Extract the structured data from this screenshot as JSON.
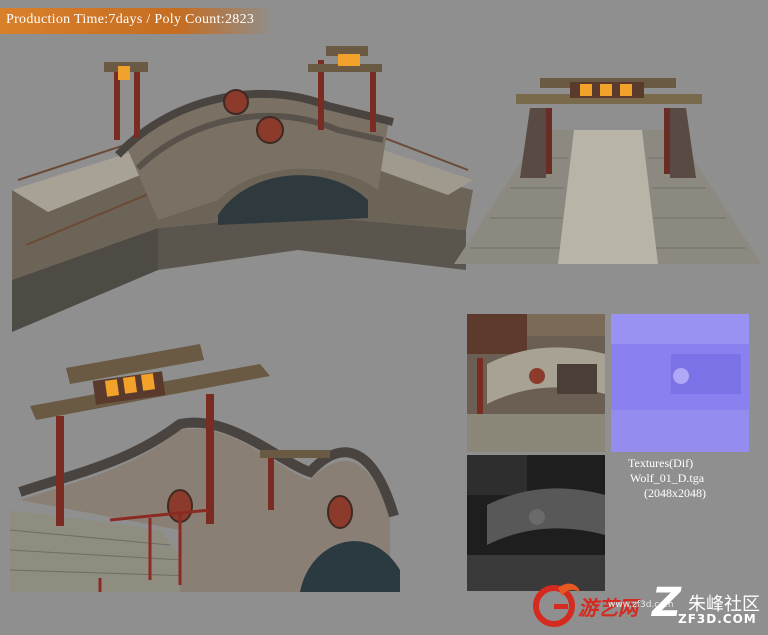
{
  "header": {
    "title": "Production Time:7days / Poly Count:2823"
  },
  "textures": {
    "caption_title": "Textures(Dif)",
    "caption_file": "Wolf_01_D.tga",
    "caption_size": "(2048x2048)"
  },
  "watermark": {
    "logo_text": "游艺网",
    "brand_cn": "朱峰社区",
    "brand_site": "ZF3D.COM",
    "url": "www.zf3d.com"
  },
  "colors": {
    "background": "#8f8f8f",
    "header_bar": "#d9802a",
    "lantern_glow": "#f2a12a",
    "normal_map": "#8a80f0"
  }
}
